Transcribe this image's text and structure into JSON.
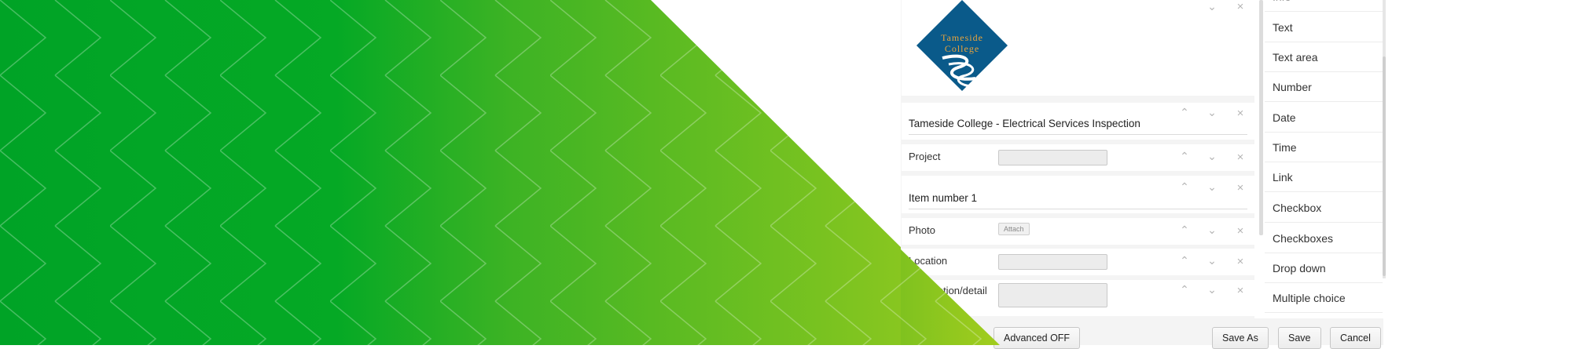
{
  "background": {
    "green_dark": "#00a326",
    "green_light": "#9fcc1e",
    "pattern_line": "#ffffff"
  },
  "logo": {
    "line1": "Tameside",
    "line2": "College",
    "fill": "#0a5a8a",
    "accent": "#e8a33c"
  },
  "form": {
    "title": "Tameside College - Electrical Services Inspection",
    "fields": [
      {
        "label": "Project",
        "type": "text"
      },
      {
        "label": "Item number 1",
        "type": "heading"
      },
      {
        "label": "Photo",
        "type": "photo",
        "button": "Attach"
      },
      {
        "label": "Location",
        "type": "text"
      },
      {
        "label": "Description/detail",
        "type": "textarea"
      }
    ],
    "controls": {
      "up": "⌃",
      "down": "⌄",
      "delete": "×"
    }
  },
  "palette": {
    "partial_top": "Info",
    "items": [
      "Text",
      "Text area",
      "Number",
      "Date",
      "Time",
      "Link",
      "Checkbox",
      "Checkboxes",
      "Drop down",
      "Multiple choice"
    ]
  },
  "footer": {
    "advanced": "Advanced OFF",
    "save_as": "Save As",
    "save": "Save",
    "cancel": "Cancel"
  }
}
